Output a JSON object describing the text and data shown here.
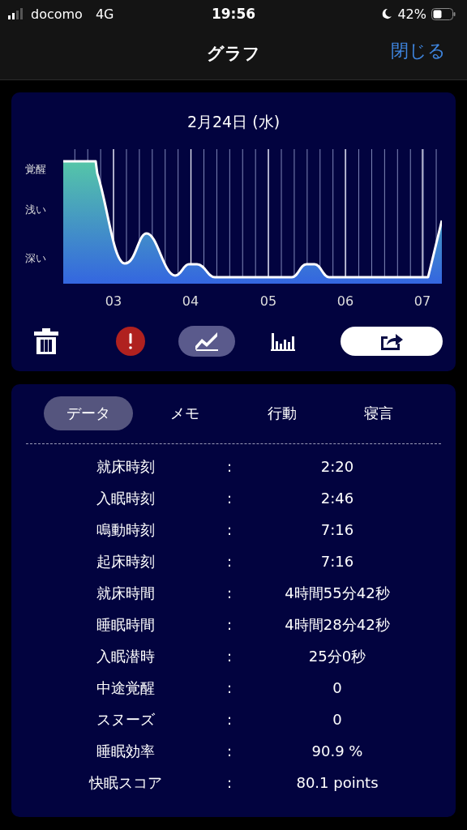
{
  "status_bar": {
    "carrier": "docomo",
    "network": "4G",
    "time": "19:56",
    "battery": "42%"
  },
  "nav": {
    "title": "グラフ",
    "close": "閉じる"
  },
  "graph_card": {
    "date": "2月24日 (水)",
    "y_labels": [
      "覚醒",
      "浅い",
      "深い"
    ],
    "x_labels": [
      "03",
      "04",
      "05",
      "06",
      "07"
    ],
    "views": [
      {
        "kind": "line",
        "selected": true
      },
      {
        "kind": "bar",
        "selected": false
      }
    ]
  },
  "tabs": [
    {
      "label": "データ",
      "selected": true
    },
    {
      "label": "メモ",
      "selected": false
    },
    {
      "label": "行動",
      "selected": false
    },
    {
      "label": "寝言",
      "selected": false
    }
  ],
  "rows": [
    {
      "label": "就床時刻",
      "sep": ":",
      "value": "2:20"
    },
    {
      "label": "入眠時刻",
      "sep": ":",
      "value": "2:46"
    },
    {
      "label": "鳴動時刻",
      "sep": ":",
      "value": "7:16"
    },
    {
      "label": "起床時刻",
      "sep": ":",
      "value": "7:16"
    },
    {
      "label": "就床時間",
      "sep": ":",
      "value": "4時間55分42秒"
    },
    {
      "label": "睡眠時間",
      "sep": ":",
      "value": "4時間28分42秒"
    },
    {
      "label": "入眠潜時",
      "sep": ":",
      "value": "25分0秒"
    },
    {
      "label": "中途覚醒",
      "sep": ":",
      "value": "0"
    },
    {
      "label": "スヌーズ",
      "sep": ":",
      "value": "0"
    },
    {
      "label": "睡眠効率",
      "sep": ":",
      "value": "90.9 %"
    },
    {
      "label": "快眠スコア",
      "sep": ":",
      "value": "80.1 points"
    }
  ]
}
